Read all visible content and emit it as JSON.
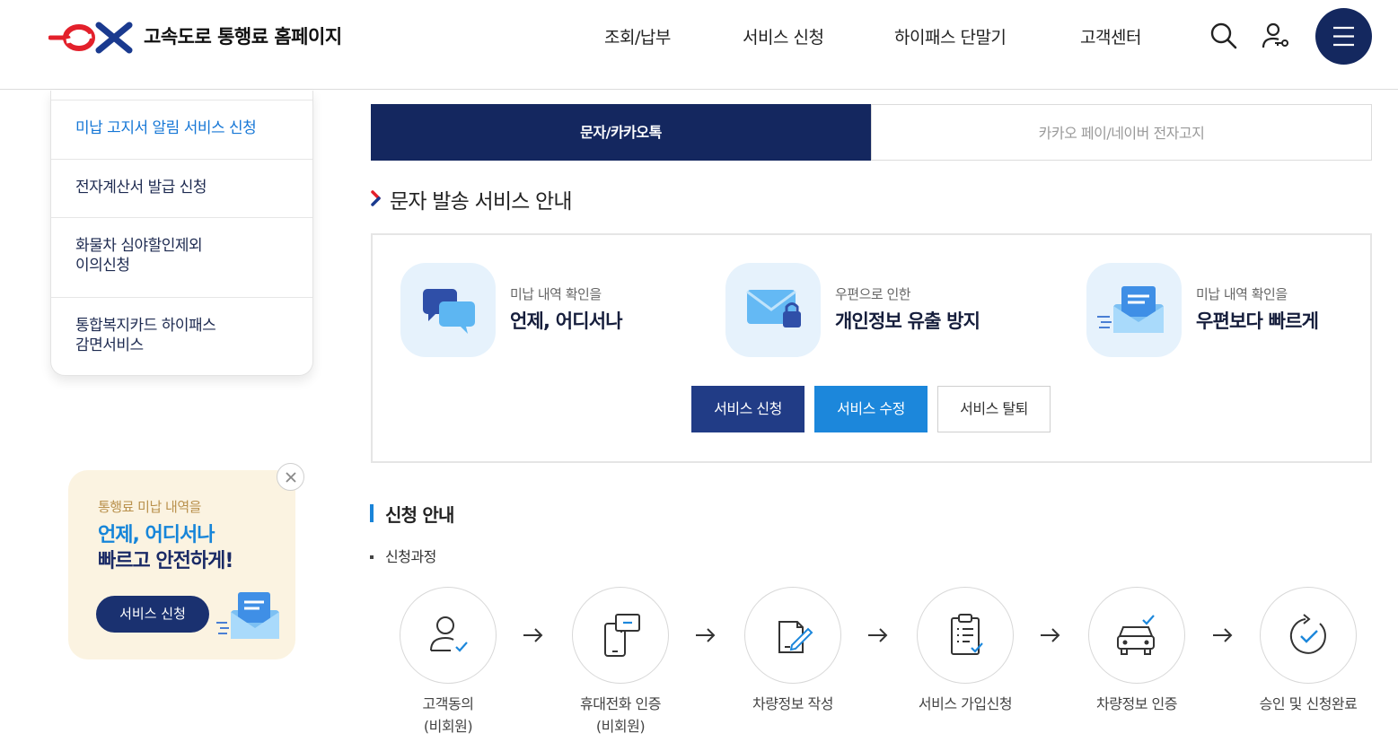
{
  "header": {
    "logo_text": "ex",
    "site_title": "고속도로 통행료 홈페이지",
    "nav": [
      "조회/납부",
      "서비스 신청",
      "하이패스 단말기",
      "고객센터"
    ],
    "icons": [
      "search-icon",
      "user-key-icon",
      "hamburger-menu-icon"
    ]
  },
  "sidebar": {
    "items": [
      {
        "label": "미납 고지서 알림 서비스 신청",
        "active": true
      },
      {
        "label": "전자계산서 발급 신청",
        "active": false
      },
      {
        "label": "화물차 심야할인제외\n이의신청",
        "active": false
      },
      {
        "label": "통합복지카드 하이패스\n감면서비스",
        "active": false
      }
    ]
  },
  "promo": {
    "subtitle": "통행료 미납 내역을",
    "headline_1": "언제, 어디서나",
    "headline_2": "빠르고 안전하게!",
    "button": "서비스 신청"
  },
  "tabs": [
    {
      "label": "문자/카카오톡",
      "selected": true
    },
    {
      "label": "카카오 페이/네이버 전자고지",
      "selected": false
    }
  ],
  "section_title": "문자 발송 서비스 안내",
  "features": [
    {
      "icon": "chat-bubbles-icon",
      "sub": "미납 내역 확인을",
      "main": "언제, 어디서나"
    },
    {
      "icon": "envelope-lock-icon",
      "sub": "우편으로 인한",
      "main": "개인정보 유출 방지"
    },
    {
      "icon": "fast-mail-icon",
      "sub": "미납 내역 확인을",
      "main": "우편보다 빠르게"
    }
  ],
  "buttons": {
    "apply": "서비스 신청",
    "edit": "서비스 수정",
    "quit": "서비스 탈퇴"
  },
  "guide": {
    "title": "신청 안내",
    "process_label": "신청과정",
    "steps": [
      {
        "icon": "user-check-icon",
        "label": "고객동의\n(비회원)"
      },
      {
        "icon": "phone-message-icon",
        "label": "휴대전화 인증\n(비회원)"
      },
      {
        "icon": "document-edit-icon",
        "label": "차량정보 작성"
      },
      {
        "icon": "clipboard-check-icon",
        "label": "서비스 가입신청"
      },
      {
        "icon": "car-check-icon",
        "label": "차량정보 인증"
      },
      {
        "icon": "refresh-check-icon",
        "label": "승인 및 신청완료"
      }
    ]
  },
  "colors": {
    "navy": "#14275f",
    "blue": "#1c87db",
    "brand_red": "#e3202b",
    "brand_blue": "#1a3a8f"
  }
}
